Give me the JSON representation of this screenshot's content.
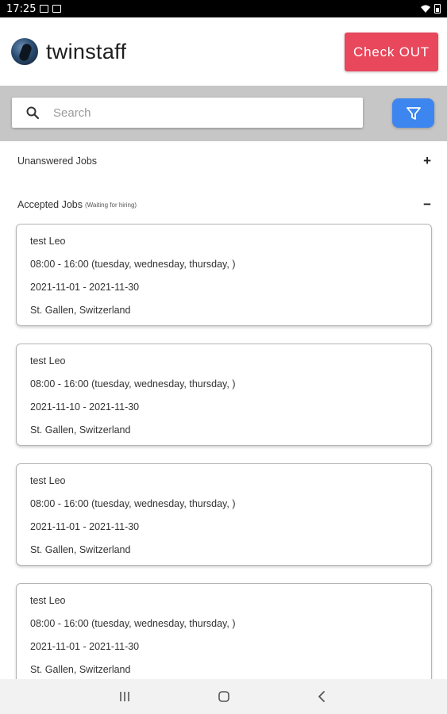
{
  "status_bar": {
    "time": "17:25"
  },
  "header": {
    "brand": "twinstaff",
    "checkout_label": "Check OUT"
  },
  "search": {
    "placeholder": "Search"
  },
  "sections": {
    "unanswered": {
      "label": "Unanswered Jobs",
      "toggle": "+"
    },
    "accepted": {
      "label": "Accepted Jobs",
      "sublabel": "(Waiting for hiring)",
      "toggle": "−"
    }
  },
  "jobs": [
    {
      "title": "test Leo",
      "schedule": "08:00 - 16:00 (tuesday, wednesday, thursday, )",
      "dates": "2021-11-01 - 2021-11-30",
      "location": "St. Gallen, Switzerland"
    },
    {
      "title": "test Leo",
      "schedule": "08:00 - 16:00 (tuesday, wednesday, thursday, )",
      "dates": "2021-11-10 - 2021-11-30",
      "location": "St. Gallen, Switzerland"
    },
    {
      "title": "test Leo",
      "schedule": "08:00 - 16:00 (tuesday, wednesday, thursday, )",
      "dates": "2021-11-01 - 2021-11-30",
      "location": "St. Gallen, Switzerland"
    },
    {
      "title": "test Leo",
      "schedule": "08:00 - 16:00 (tuesday, wednesday, thursday, )",
      "dates": "2021-11-01 - 2021-11-30",
      "location": "St. Gallen, Switzerland"
    }
  ],
  "icons": {
    "status_left": [
      "image-icon",
      "notification-icon"
    ],
    "status_right": [
      "wifi-icon",
      "battery-icon"
    ],
    "search": "search-icon",
    "filter": "filter-icon",
    "nav": [
      "recent-apps-icon",
      "home-icon",
      "back-icon"
    ]
  },
  "colors": {
    "checkout": "#e8475c",
    "filter": "#3d86f0",
    "search_strip": "#c6c6c6"
  }
}
